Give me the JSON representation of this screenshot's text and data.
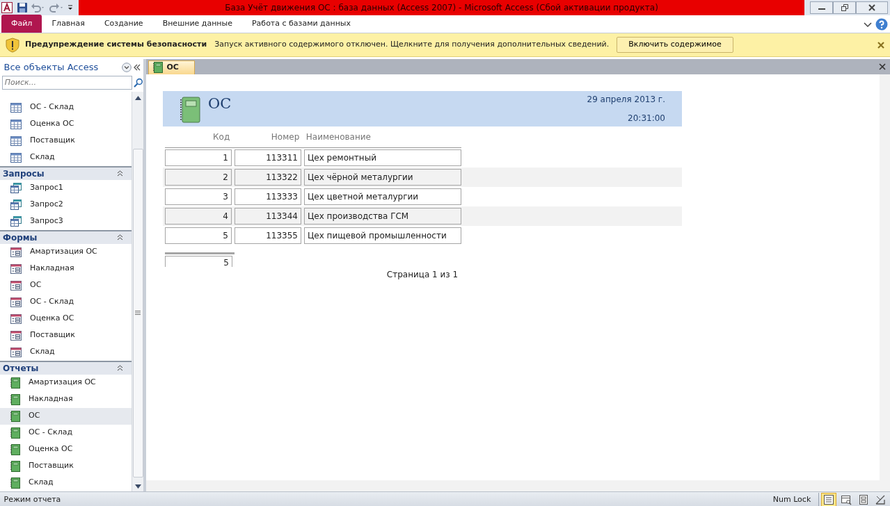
{
  "window": {
    "title": "База Учёт движения ОС : база данных (Access 2007)  -  Microsoft Access (Сбой активации продукта)"
  },
  "ribbon_tabs": [
    {
      "label": "Файл",
      "kind": "file",
      "selected": false
    },
    {
      "label": "Главная",
      "kind": "tab",
      "selected": false
    },
    {
      "label": "Создание",
      "kind": "tab",
      "selected": false
    },
    {
      "label": "Внешние данные",
      "kind": "tab",
      "selected": false
    },
    {
      "label": "Работа с базами данных",
      "kind": "tab",
      "selected": false
    }
  ],
  "message_bar": {
    "title": "Предупреждение системы безопасности",
    "text": "Запуск активного содержимого отключен. Щелкните для получения дополнительных сведений.",
    "button": "Включить содержимое"
  },
  "navigation": {
    "title": "Все объекты Access",
    "search": {
      "placeholder": "Поиск..."
    },
    "groups": [
      {
        "kind": "table",
        "items": [
          {
            "label": "ОС - Склад",
            "selected": false
          },
          {
            "label": "Оценка ОС",
            "selected": false
          },
          {
            "label": "Поставщик",
            "selected": false
          },
          {
            "label": "Склад",
            "selected": false
          }
        ]
      },
      {
        "kind": "query",
        "title": "Запросы",
        "expanded": true,
        "items": [
          {
            "label": "Запрос1",
            "selected": false
          },
          {
            "label": "Запрос2",
            "selected": false
          },
          {
            "label": "Запрос3",
            "selected": false
          }
        ]
      },
      {
        "kind": "form",
        "title": "Формы",
        "expanded": true,
        "items": [
          {
            "label": "Амартизация ОС",
            "selected": false
          },
          {
            "label": "Накладная",
            "selected": false
          },
          {
            "label": "ОС",
            "selected": false
          },
          {
            "label": "ОС - Склад",
            "selected": false
          },
          {
            "label": "Оценка ОС",
            "selected": false
          },
          {
            "label": "Поставщик",
            "selected": false
          },
          {
            "label": "Склад",
            "selected": false
          }
        ]
      },
      {
        "kind": "report",
        "title": "Отчеты",
        "expanded": true,
        "items": [
          {
            "label": "Амартизация ОС",
            "selected": false
          },
          {
            "label": "Накладная",
            "selected": false
          },
          {
            "label": "ОС",
            "selected": true
          },
          {
            "label": "ОС - Склад",
            "selected": false
          },
          {
            "label": "Оценка ОС",
            "selected": false
          },
          {
            "label": "Поставщик",
            "selected": false
          },
          {
            "label": "Склад",
            "selected": false
          }
        ]
      }
    ]
  },
  "document_tabs": [
    {
      "label": "ОС",
      "selected": true
    }
  ],
  "report": {
    "title": "ОС",
    "date": "29 апреля 2013 г.",
    "time": "20:31:00",
    "columns": [
      "Код",
      "Номер",
      "Наименование"
    ],
    "rows": [
      {
        "cells": [
          "1",
          "113311",
          "Цех ремонтный"
        ]
      },
      {
        "cells": [
          "2",
          "113322",
          "Цех чёрной металургии"
        ]
      },
      {
        "cells": [
          "3",
          "113333",
          "Цех цветной металургии"
        ]
      },
      {
        "cells": [
          "4",
          "113344",
          "Цех производства ГСМ"
        ]
      },
      {
        "cells": [
          "5",
          "113355",
          "Цех пищевой промышленности"
        ]
      }
    ],
    "count": "5",
    "page_footer": "Страница 1 из 1"
  },
  "status_bar": {
    "text": "Режим отчета",
    "num_lock": "Num Lock",
    "views": [
      {
        "selected": true
      },
      {
        "selected": false
      },
      {
        "selected": false
      },
      {
        "selected": false
      }
    ]
  }
}
